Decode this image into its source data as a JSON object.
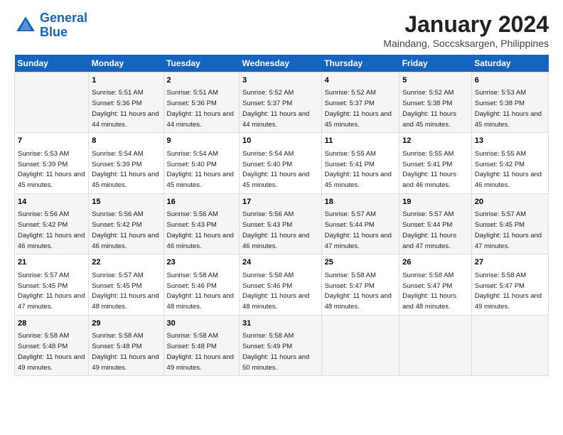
{
  "logo": {
    "line1": "General",
    "line2": "Blue"
  },
  "title": "January 2024",
  "subtitle": "Maindang, Soccsksargen, Philippines",
  "weekdays": [
    "Sunday",
    "Monday",
    "Tuesday",
    "Wednesday",
    "Thursday",
    "Friday",
    "Saturday"
  ],
  "weeks": [
    [
      {
        "num": "",
        "sunrise": "",
        "sunset": "",
        "daylight": ""
      },
      {
        "num": "1",
        "sunrise": "Sunrise: 5:51 AM",
        "sunset": "Sunset: 5:36 PM",
        "daylight": "Daylight: 11 hours and 44 minutes."
      },
      {
        "num": "2",
        "sunrise": "Sunrise: 5:51 AM",
        "sunset": "Sunset: 5:36 PM",
        "daylight": "Daylight: 11 hours and 44 minutes."
      },
      {
        "num": "3",
        "sunrise": "Sunrise: 5:52 AM",
        "sunset": "Sunset: 5:37 PM",
        "daylight": "Daylight: 11 hours and 44 minutes."
      },
      {
        "num": "4",
        "sunrise": "Sunrise: 5:52 AM",
        "sunset": "Sunset: 5:37 PM",
        "daylight": "Daylight: 11 hours and 45 minutes."
      },
      {
        "num": "5",
        "sunrise": "Sunrise: 5:52 AM",
        "sunset": "Sunset: 5:38 PM",
        "daylight": "Daylight: 11 hours and 45 minutes."
      },
      {
        "num": "6",
        "sunrise": "Sunrise: 5:53 AM",
        "sunset": "Sunset: 5:38 PM",
        "daylight": "Daylight: 11 hours and 45 minutes."
      }
    ],
    [
      {
        "num": "7",
        "sunrise": "Sunrise: 5:53 AM",
        "sunset": "Sunset: 5:39 PM",
        "daylight": "Daylight: 11 hours and 45 minutes."
      },
      {
        "num": "8",
        "sunrise": "Sunrise: 5:54 AM",
        "sunset": "Sunset: 5:39 PM",
        "daylight": "Daylight: 11 hours and 45 minutes."
      },
      {
        "num": "9",
        "sunrise": "Sunrise: 5:54 AM",
        "sunset": "Sunset: 5:40 PM",
        "daylight": "Daylight: 11 hours and 45 minutes."
      },
      {
        "num": "10",
        "sunrise": "Sunrise: 5:54 AM",
        "sunset": "Sunset: 5:40 PM",
        "daylight": "Daylight: 11 hours and 45 minutes."
      },
      {
        "num": "11",
        "sunrise": "Sunrise: 5:55 AM",
        "sunset": "Sunset: 5:41 PM",
        "daylight": "Daylight: 11 hours and 45 minutes."
      },
      {
        "num": "12",
        "sunrise": "Sunrise: 5:55 AM",
        "sunset": "Sunset: 5:41 PM",
        "daylight": "Daylight: 11 hours and 46 minutes."
      },
      {
        "num": "13",
        "sunrise": "Sunrise: 5:55 AM",
        "sunset": "Sunset: 5:42 PM",
        "daylight": "Daylight: 11 hours and 46 minutes."
      }
    ],
    [
      {
        "num": "14",
        "sunrise": "Sunrise: 5:56 AM",
        "sunset": "Sunset: 5:42 PM",
        "daylight": "Daylight: 11 hours and 46 minutes."
      },
      {
        "num": "15",
        "sunrise": "Sunrise: 5:56 AM",
        "sunset": "Sunset: 5:42 PM",
        "daylight": "Daylight: 11 hours and 46 minutes."
      },
      {
        "num": "16",
        "sunrise": "Sunrise: 5:56 AM",
        "sunset": "Sunset: 5:43 PM",
        "daylight": "Daylight: 11 hours and 46 minutes."
      },
      {
        "num": "17",
        "sunrise": "Sunrise: 5:56 AM",
        "sunset": "Sunset: 5:43 PM",
        "daylight": "Daylight: 11 hours and 46 minutes."
      },
      {
        "num": "18",
        "sunrise": "Sunrise: 5:57 AM",
        "sunset": "Sunset: 5:44 PM",
        "daylight": "Daylight: 11 hours and 47 minutes."
      },
      {
        "num": "19",
        "sunrise": "Sunrise: 5:57 AM",
        "sunset": "Sunset: 5:44 PM",
        "daylight": "Daylight: 11 hours and 47 minutes."
      },
      {
        "num": "20",
        "sunrise": "Sunrise: 5:57 AM",
        "sunset": "Sunset: 5:45 PM",
        "daylight": "Daylight: 11 hours and 47 minutes."
      }
    ],
    [
      {
        "num": "21",
        "sunrise": "Sunrise: 5:57 AM",
        "sunset": "Sunset: 5:45 PM",
        "daylight": "Daylight: 11 hours and 47 minutes."
      },
      {
        "num": "22",
        "sunrise": "Sunrise: 5:57 AM",
        "sunset": "Sunset: 5:45 PM",
        "daylight": "Daylight: 11 hours and 48 minutes."
      },
      {
        "num": "23",
        "sunrise": "Sunrise: 5:58 AM",
        "sunset": "Sunset: 5:46 PM",
        "daylight": "Daylight: 11 hours and 48 minutes."
      },
      {
        "num": "24",
        "sunrise": "Sunrise: 5:58 AM",
        "sunset": "Sunset: 5:46 PM",
        "daylight": "Daylight: 11 hours and 48 minutes."
      },
      {
        "num": "25",
        "sunrise": "Sunrise: 5:58 AM",
        "sunset": "Sunset: 5:47 PM",
        "daylight": "Daylight: 11 hours and 48 minutes."
      },
      {
        "num": "26",
        "sunrise": "Sunrise: 5:58 AM",
        "sunset": "Sunset: 5:47 PM",
        "daylight": "Daylight: 11 hours and 48 minutes."
      },
      {
        "num": "27",
        "sunrise": "Sunrise: 5:58 AM",
        "sunset": "Sunset: 5:47 PM",
        "daylight": "Daylight: 11 hours and 49 minutes."
      }
    ],
    [
      {
        "num": "28",
        "sunrise": "Sunrise: 5:58 AM",
        "sunset": "Sunset: 5:48 PM",
        "daylight": "Daylight: 11 hours and 49 minutes."
      },
      {
        "num": "29",
        "sunrise": "Sunrise: 5:58 AM",
        "sunset": "Sunset: 5:48 PM",
        "daylight": "Daylight: 11 hours and 49 minutes."
      },
      {
        "num": "30",
        "sunrise": "Sunrise: 5:58 AM",
        "sunset": "Sunset: 5:48 PM",
        "daylight": "Daylight: 11 hours and 49 minutes."
      },
      {
        "num": "31",
        "sunrise": "Sunrise: 5:58 AM",
        "sunset": "Sunset: 5:49 PM",
        "daylight": "Daylight: 11 hours and 50 minutes."
      },
      {
        "num": "",
        "sunrise": "",
        "sunset": "",
        "daylight": ""
      },
      {
        "num": "",
        "sunrise": "",
        "sunset": "",
        "daylight": ""
      },
      {
        "num": "",
        "sunrise": "",
        "sunset": "",
        "daylight": ""
      }
    ]
  ]
}
